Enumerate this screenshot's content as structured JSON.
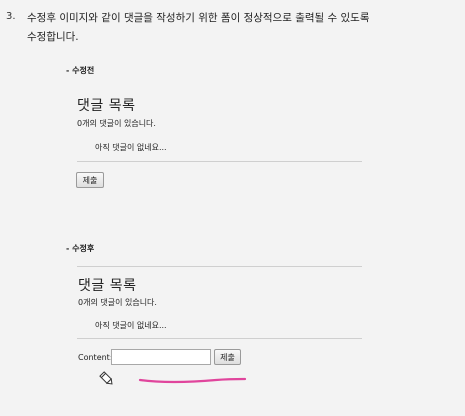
{
  "instruction": {
    "number": "3.",
    "text_line1": "수정후 이미지와 같이 댓글을 작성하기 위한 폼이 정상적으로 출력될 수 있도록",
    "text_line2": "수정합니다."
  },
  "before": {
    "label": "- 수정전",
    "title": "댓글 목록",
    "count_text": "0개의 댓글이 있습니다.",
    "empty_text": "아직 댓글이 없네요...",
    "submit_label": "제출"
  },
  "after": {
    "label": "- 수정후",
    "title": "댓글 목록",
    "count_text": "0개의 댓글이 있습니다.",
    "empty_text": "아직 댓글이 없네요...",
    "content_label": "Content:",
    "content_value": "",
    "submit_label": "제출"
  },
  "colors": {
    "background": "#f3f3f3",
    "annotation": "#e0459c"
  },
  "icons": {
    "cursor": "pencil-icon"
  }
}
